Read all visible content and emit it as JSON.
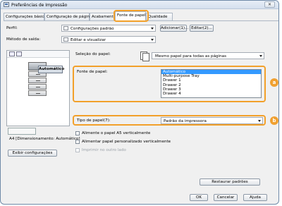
{
  "window": {
    "title": "Preferências de Impressão",
    "close": "✕"
  },
  "tabs": [
    {
      "label": "Configurações básicas"
    },
    {
      "label": "Configuração de página"
    },
    {
      "label": "Acabamento"
    },
    {
      "label": "Fonte de papel"
    },
    {
      "label": "Qualidade"
    }
  ],
  "profile": {
    "label": "Perfil:",
    "value": "Configurações padrão",
    "add_button": "Adicionar(1)...",
    "edit_button": "Editar(2)..."
  },
  "output_method": {
    "label": "Método de saída:",
    "value": "Editar e visualizar"
  },
  "preview": {
    "auto_label": "Automático",
    "size_text": "A4 [Dimensionamento: Automático]",
    "view_settings_button": "Exibir configurações"
  },
  "paper_selection": {
    "label": "Seleção do papel:",
    "value": "Mesmo papel para todas as páginas"
  },
  "paper_source": {
    "label": "Fonte de papel:",
    "options": [
      "Automático",
      "Multi-purpose Tray",
      "Drawer 1",
      "Drawer 2",
      "Drawer 3",
      "Drawer 4"
    ],
    "selected_index": 0
  },
  "paper_type": {
    "label": "Tipo de papel(7):",
    "value": "Padrão da impressora"
  },
  "checkboxes": [
    {
      "label": "Alimente o papel A5 verticalmente",
      "checked": false,
      "enabled": true
    },
    {
      "label": "Alimentar papel personalizado verticalmente",
      "checked": false,
      "enabled": true
    },
    {
      "label": "Imprimir no outro lado",
      "checked": false,
      "enabled": false
    }
  ],
  "restore_button": "Restaurar padrões",
  "footer": {
    "ok": "OK",
    "cancel": "Cancelar",
    "help": "Ajuda"
  },
  "callouts": {
    "a": "a",
    "b": "b"
  },
  "colors": {
    "highlight": "#f2a02a",
    "selection": "#3399ff"
  }
}
